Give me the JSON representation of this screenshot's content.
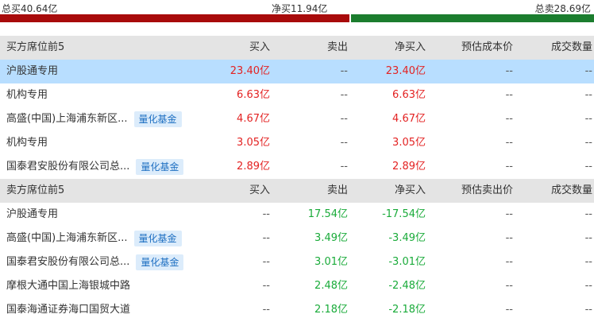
{
  "summary": {
    "total_buy": "总买40.64亿",
    "net_buy": "净买11.94亿",
    "total_sell": "总卖28.69亿",
    "buy_share": 0.586
  },
  "buy_section": {
    "headers": [
      "买方席位前5",
      "买入",
      "卖出",
      "净买入",
      "预估成本价",
      "成交数量"
    ],
    "rows": [
      {
        "name": "沪股通专用",
        "tag": "",
        "buy": "23.40亿",
        "sell": "--",
        "net": "23.40亿",
        "price": "--",
        "qty": "--"
      },
      {
        "name": "机构专用",
        "tag": "",
        "buy": "6.63亿",
        "sell": "--",
        "net": "6.63亿",
        "price": "--",
        "qty": "--"
      },
      {
        "name": "高盛(中国)上海浦东新区...",
        "tag": "量化基金",
        "buy": "4.67亿",
        "sell": "--",
        "net": "4.67亿",
        "price": "--",
        "qty": "--"
      },
      {
        "name": "机构专用",
        "tag": "",
        "buy": "3.05亿",
        "sell": "--",
        "net": "3.05亿",
        "price": "--",
        "qty": "--"
      },
      {
        "name": "国泰君安股份有限公司总...",
        "tag": "量化基金",
        "buy": "2.89亿",
        "sell": "--",
        "net": "2.89亿",
        "price": "--",
        "qty": "--"
      }
    ]
  },
  "sell_section": {
    "headers": [
      "卖方席位前5",
      "买入",
      "卖出",
      "净买入",
      "预估卖出价",
      "成交数量"
    ],
    "rows": [
      {
        "name": "沪股通专用",
        "tag": "",
        "buy": "--",
        "sell": "17.54亿",
        "net": "-17.54亿",
        "price": "--",
        "qty": "--"
      },
      {
        "name": "高盛(中国)上海浦东新区...",
        "tag": "量化基金",
        "buy": "--",
        "sell": "3.49亿",
        "net": "-3.49亿",
        "price": "--",
        "qty": "--"
      },
      {
        "name": "国泰君安股份有限公司总...",
        "tag": "量化基金",
        "buy": "--",
        "sell": "3.01亿",
        "net": "-3.01亿",
        "price": "--",
        "qty": "--"
      },
      {
        "name": "摩根大通中国上海银城中路",
        "tag": "",
        "buy": "--",
        "sell": "2.48亿",
        "net": "-2.48亿",
        "price": "--",
        "qty": "--"
      },
      {
        "name": "国泰海通证券海口国贸大道",
        "tag": "",
        "buy": "--",
        "sell": "2.18亿",
        "net": "-2.18亿",
        "price": "--",
        "qty": "--"
      }
    ]
  },
  "colors": {
    "buy": "#a80b0b",
    "sell": "#1b7d2e",
    "up": "#e32222",
    "down": "#1aab3a",
    "highlight": "#b8deff"
  }
}
